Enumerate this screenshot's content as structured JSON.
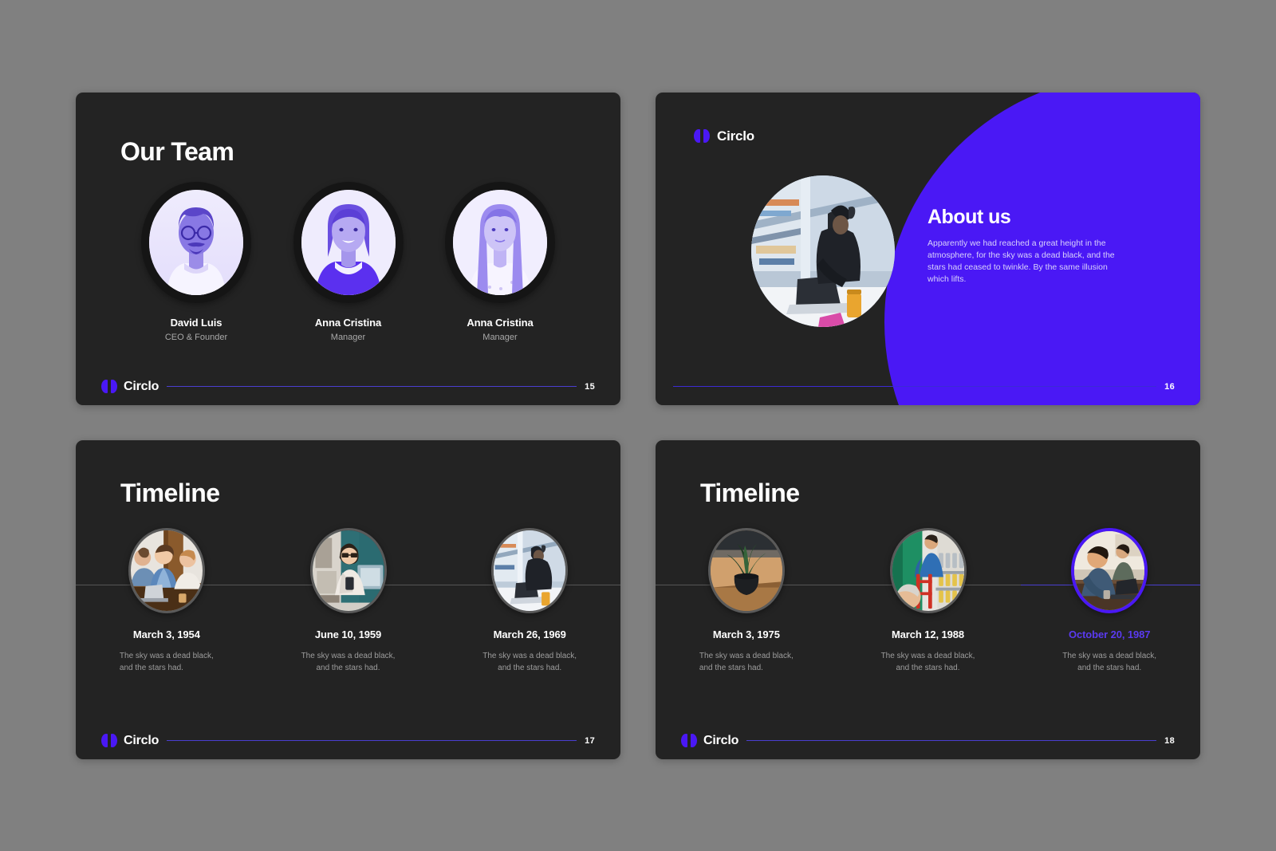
{
  "theme": {
    "page_bg": "#808080",
    "slide_bg": "#232323",
    "accent": "#4a18f5",
    "accent_line": "#4a3fd0",
    "text": "#ffffff",
    "muted": "#9d9d9d"
  },
  "brand": {
    "name": "Circlo",
    "icon": "circlo-logo-icon"
  },
  "slides": [
    {
      "id": "our-team",
      "page": "15",
      "title": "Our Team",
      "members": [
        {
          "name": "David Luis",
          "role": "CEO & Founder",
          "photo": "portrait-man-glasses"
        },
        {
          "name": "Anna Cristina",
          "role": "Manager",
          "photo": "portrait-woman-short-hair"
        },
        {
          "name": "Anna Cristina",
          "role": "Manager",
          "photo": "portrait-woman-long-hair"
        }
      ]
    },
    {
      "id": "about-us",
      "page": "16",
      "title": "About us",
      "body": "Apparently  we had reached a great height in the atmosphere, for the sky was a dead black, and the stars had ceased to twinkle. By the same illusion which lifts.",
      "photo": "photo-woman-laptop-window"
    },
    {
      "id": "timeline-1",
      "page": "17",
      "title": "Timeline",
      "events": [
        {
          "date": "March 3, 1954",
          "desc": "The sky was a dead black,\nand the stars had.",
          "photo": "photo-team-meeting",
          "active": false
        },
        {
          "date": "June 10, 1959",
          "desc": "The sky was a dead black,\nand the stars had.",
          "photo": "photo-woman-phone-desk",
          "active": false
        },
        {
          "date": "March 26, 1969",
          "desc": "The sky was a dead black,\nand the stars had.",
          "photo": "photo-woman-laptop-window",
          "active": false
        }
      ]
    },
    {
      "id": "timeline-2",
      "page": "18",
      "title": "Timeline",
      "events": [
        {
          "date": "March 3, 1975",
          "desc": "The sky was a dead black,\nand the stars had.",
          "photo": "photo-plant-pot-table",
          "active": false
        },
        {
          "date": "March 12, 1988",
          "desc": "The sky was a dead black,\nand the stars had.",
          "photo": "photo-store-shelves",
          "active": false
        },
        {
          "date": "October 20, 1987",
          "desc": "The sky was a dead black,\nand the stars had.",
          "photo": "photo-men-at-desk",
          "active": true
        }
      ]
    }
  ]
}
